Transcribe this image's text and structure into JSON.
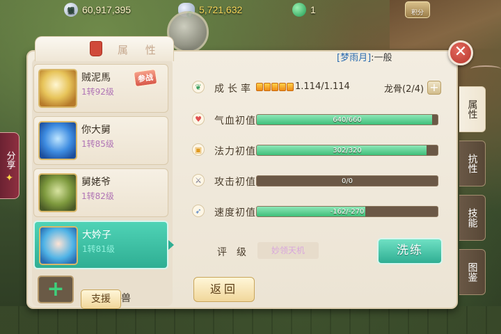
{
  "resources": {
    "silver": {
      "icon": "silver-coin-icon",
      "glyph": "银",
      "value": "60,917,395"
    },
    "gold": {
      "icon": "gold-ingot-icon",
      "value": "5,721,632"
    },
    "jade": {
      "icon": "jade-gem-icon",
      "value": "1"
    },
    "points_label": "积分"
  },
  "share": {
    "label": "分享"
  },
  "panel": {
    "header_label": "属 性",
    "pet_title_prefix": "[梦雨月]",
    "pet_title_suffix": ":一般",
    "close_glyph": "✕"
  },
  "pets": [
    {
      "name": "贼泥馬",
      "level": "1转92级",
      "badge": "参战"
    },
    {
      "name": "你大舅",
      "level": "1转85级"
    },
    {
      "name": "舅姥爷",
      "level": "1转82级"
    },
    {
      "name": "大妗子",
      "level": "1转81级"
    }
  ],
  "support": {
    "add_glyph": "+",
    "button": "支援",
    "suffix": "兽"
  },
  "attributes": {
    "growth": {
      "label": "成长率",
      "value": "1.114/1.114",
      "squares": 5
    },
    "bone": {
      "label": "龙骨(2/4)",
      "plus": "+"
    },
    "hp": {
      "label": "气血初值",
      "text": "640/660",
      "fill": 0.97
    },
    "mp": {
      "label": "法力初值",
      "text": "302/320",
      "fill": 0.94
    },
    "atk": {
      "label": "攻击初值",
      "text": "0/0",
      "fill": 0
    },
    "spd": {
      "label": "速度初值",
      "text": "-162/-270",
      "fill": 0.6
    },
    "grade_label": "评级",
    "grade_value": "妙领天机"
  },
  "buttons": {
    "wash": "洗练",
    "back": "返回"
  },
  "side_tabs": [
    "属性",
    "抗性",
    "技能",
    "图鉴"
  ],
  "colors": {
    "accent_teal": "#2fae93",
    "bar_green": "#3fbf7a",
    "close_red": "#b7352c"
  }
}
